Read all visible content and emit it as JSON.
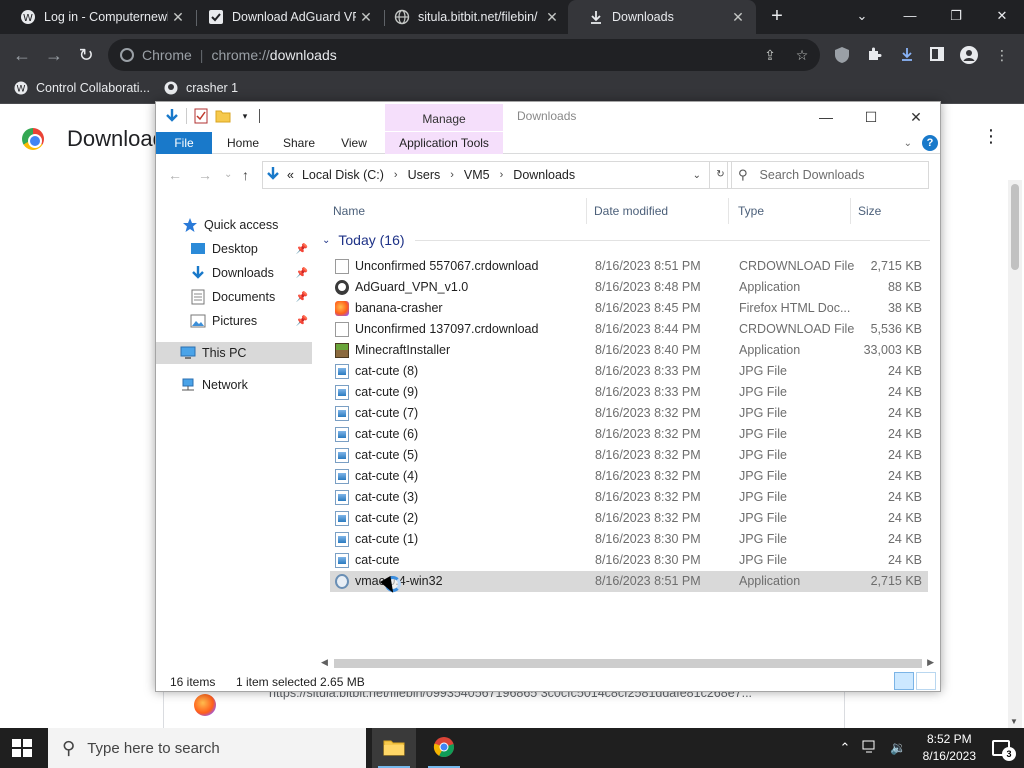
{
  "chrome": {
    "tabs": [
      {
        "title": "Log in - Computernewb",
        "icon": "wiki-icon",
        "active": false
      },
      {
        "title": "Download AdGuard VPN",
        "icon": "adguard-icon",
        "active": false
      },
      {
        "title": "situla.bitbit.net/filebin/",
        "icon": "globe-icon",
        "active": false
      },
      {
        "title": "Downloads",
        "icon": "download-icon",
        "active": true
      }
    ],
    "new_tab_label": "+",
    "omnibox": {
      "scheme_label": "Chrome",
      "url_prefix": "chrome://",
      "url_host": "downloads"
    },
    "bookmarks": [
      {
        "label": "Control Collaborati...",
        "icon": "wiki-icon"
      },
      {
        "label": "crasher 1",
        "icon": "github-icon"
      }
    ],
    "page": {
      "title": "Downloads",
      "download_url": "https://situla.bitbit.net/filebin/0993540567196865 3c0cfc5014c8cf2581ddafe81c268e7..."
    }
  },
  "explorer": {
    "window_title": "Downloads",
    "context_tab": "Manage",
    "ribbon_tabs": [
      "File",
      "Home",
      "Share",
      "View",
      "Application Tools"
    ],
    "address": {
      "prefix": "«",
      "segments": [
        "Local Disk (C:)",
        "Users",
        "VM5",
        "Downloads"
      ]
    },
    "search_placeholder": "Search Downloads",
    "nav": [
      {
        "label": "Quick access",
        "icon": "star-icon",
        "pinned": false,
        "indent": 0
      },
      {
        "label": "Desktop",
        "icon": "desktop-folder-icon",
        "pinned": true,
        "indent": 1
      },
      {
        "label": "Downloads",
        "icon": "downloads-folder-icon",
        "pinned": true,
        "indent": 1
      },
      {
        "label": "Documents",
        "icon": "documents-folder-icon",
        "pinned": true,
        "indent": 1
      },
      {
        "label": "Pictures",
        "icon": "pictures-folder-icon",
        "pinned": true,
        "indent": 1
      },
      {
        "label": "This PC",
        "icon": "pc-icon",
        "pinned": false,
        "indent": 0,
        "selected": true
      },
      {
        "label": "Network",
        "icon": "network-icon",
        "pinned": false,
        "indent": 0
      }
    ],
    "columns": {
      "name": "Name",
      "date": "Date modified",
      "type": "Type",
      "size": "Size"
    },
    "group": "Today (16)",
    "files": [
      {
        "name": "Unconfirmed 557067.crdownload",
        "date": "8/16/2023 8:51 PM",
        "type": "CRDOWNLOAD File",
        "size": "2,715 KB",
        "icon": "doc"
      },
      {
        "name": "AdGuard_VPN_v1.0",
        "date": "8/16/2023 8:48 PM",
        "type": "Application",
        "size": "88 KB",
        "icon": "app-ag"
      },
      {
        "name": "banana-crasher",
        "date": "8/16/2023 8:45 PM",
        "type": "Firefox HTML Doc...",
        "size": "38 KB",
        "icon": "ff"
      },
      {
        "name": "Unconfirmed 137097.crdownload",
        "date": "8/16/2023 8:44 PM",
        "type": "CRDOWNLOAD File",
        "size": "5,536 KB",
        "icon": "doc"
      },
      {
        "name": "MinecraftInstaller",
        "date": "8/16/2023 8:40 PM",
        "type": "Application",
        "size": "33,003 KB",
        "icon": "mc"
      },
      {
        "name": "cat-cute (8)",
        "date": "8/16/2023 8:33 PM",
        "type": "JPG File",
        "size": "24 KB",
        "icon": "jpg"
      },
      {
        "name": "cat-cute (9)",
        "date": "8/16/2023 8:33 PM",
        "type": "JPG File",
        "size": "24 KB",
        "icon": "jpg"
      },
      {
        "name": "cat-cute (7)",
        "date": "8/16/2023 8:32 PM",
        "type": "JPG File",
        "size": "24 KB",
        "icon": "jpg"
      },
      {
        "name": "cat-cute (6)",
        "date": "8/16/2023 8:32 PM",
        "type": "JPG File",
        "size": "24 KB",
        "icon": "jpg"
      },
      {
        "name": "cat-cute (5)",
        "date": "8/16/2023 8:32 PM",
        "type": "JPG File",
        "size": "24 KB",
        "icon": "jpg"
      },
      {
        "name": "cat-cute (4)",
        "date": "8/16/2023 8:32 PM",
        "type": "JPG File",
        "size": "24 KB",
        "icon": "jpg"
      },
      {
        "name": "cat-cute (3)",
        "date": "8/16/2023 8:32 PM",
        "type": "JPG File",
        "size": "24 KB",
        "icon": "jpg"
      },
      {
        "name": "cat-cute (2)",
        "date": "8/16/2023 8:32 PM",
        "type": "JPG File",
        "size": "24 KB",
        "icon": "jpg"
      },
      {
        "name": "cat-cute (1)",
        "date": "8/16/2023 8:30 PM",
        "type": "JPG File",
        "size": "24 KB",
        "icon": "jpg"
      },
      {
        "name": "cat-cute",
        "date": "8/16/2023 8:30 PM",
        "type": "JPG File",
        "size": "24 KB",
        "icon": "jpg"
      },
      {
        "name": "vmac    0.4-win32",
        "date": "8/16/2023 8:51 PM",
        "type": "Application",
        "size": "2,715 KB",
        "icon": "setup",
        "highlight": true
      }
    ],
    "status": {
      "count": "16 items",
      "selection": "1 item selected  2.65 MB"
    }
  },
  "taskbar": {
    "search_placeholder": "Type here to search",
    "time": "8:52 PM",
    "date": "8/16/2023",
    "notification_count": "3"
  },
  "colors": {
    "ribbon_blue": "#1979ca",
    "manage_pink": "#f5dffb",
    "group_blue": "#1e3287",
    "selection": "#cce8ff"
  }
}
